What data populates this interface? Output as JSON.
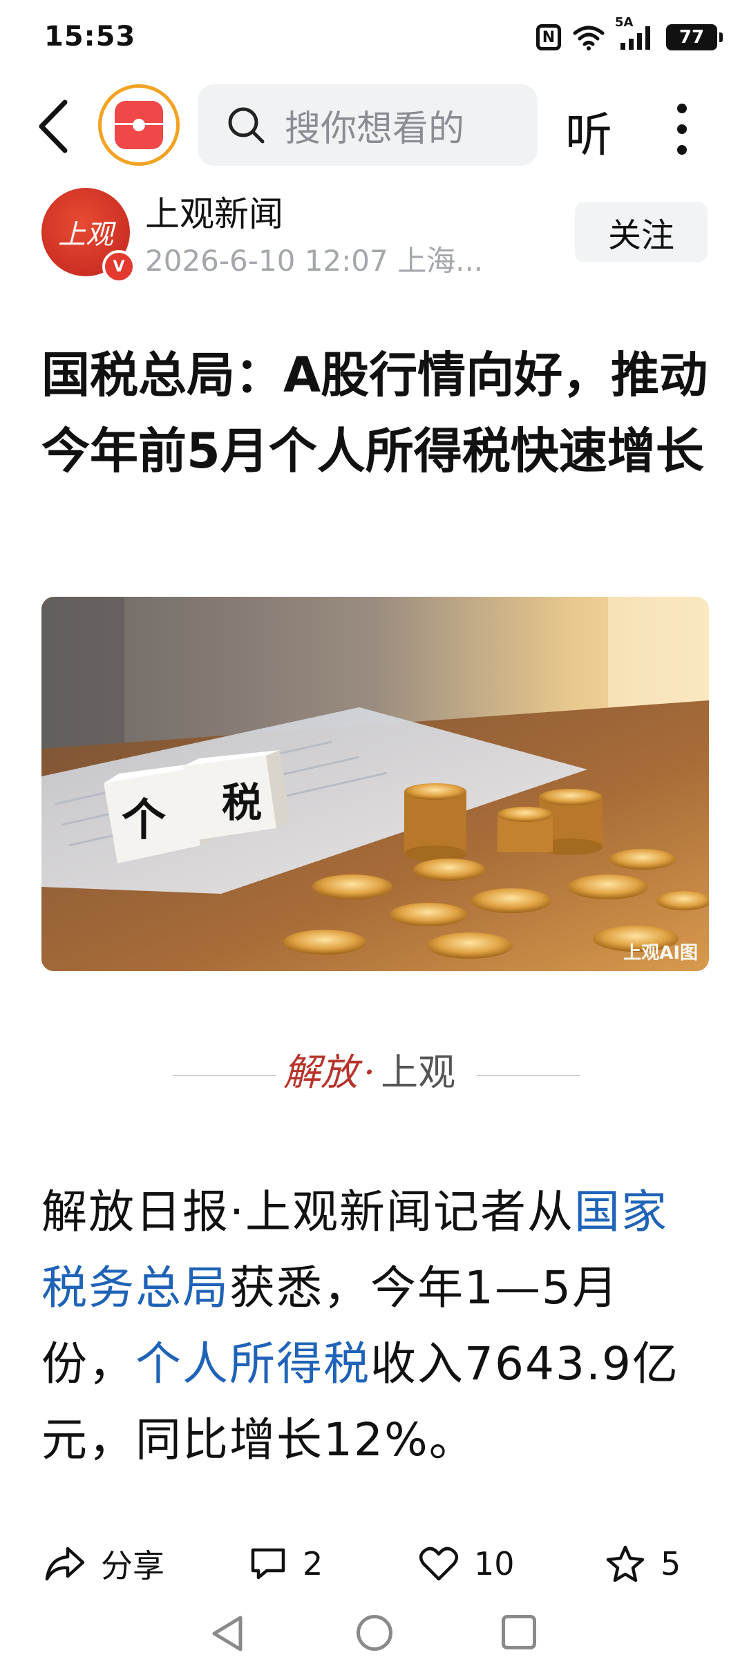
{
  "status_bar": {
    "time": "15:53",
    "network": "5A",
    "battery": "77",
    "nfc": "N"
  },
  "top_bar": {
    "search_placeholder": "搜你想看的",
    "listen_label": "听"
  },
  "author": {
    "name": "上观新闻",
    "avatar_text": "上观",
    "meta": "2026-6-10 12:07 上海...",
    "follow_label": "关注"
  },
  "article": {
    "title": "国税总局：A股行情向好，推动今年前5月个人所得税快速增长",
    "image_watermark": "上观AI图",
    "brand_logo_left": "解放",
    "brand_logo_right": "上观",
    "body": {
      "p1": "解放日报·上观新闻记者从",
      "link1": "国家税务总局",
      "p2": "获悉，今年1—5月份，",
      "link2": "个人所得税",
      "p3": "收入7643.9亿元，同比增长12%。"
    }
  },
  "actions": {
    "share_label": "分享",
    "comment_count": "2",
    "like_count": "10",
    "favorite_count": "5"
  },
  "hero_dice": {
    "left": "个",
    "right": "税"
  }
}
